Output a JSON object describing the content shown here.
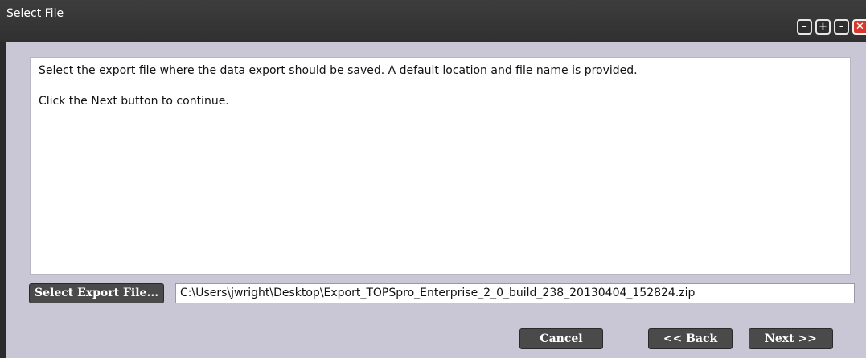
{
  "window": {
    "title": "Select File",
    "controls": {
      "minimize": "–",
      "restore": "+",
      "shrink": "-",
      "close": "✕"
    }
  },
  "message": {
    "line1": "Select the export file where the data export should be saved. A default location and file name is provided.",
    "line2": "Click the Next button to continue."
  },
  "file": {
    "button_label": "Select Export File...",
    "path": "C:\\Users\\jwright\\Desktop\\Export_TOPSpro_Enterprise_2_0_build_238_20130404_152824.zip"
  },
  "nav": {
    "cancel": "Cancel",
    "back": "<< Back",
    "next": "Next >>"
  },
  "colors": {
    "titlebar": "#333333",
    "body": "#c9c6d5",
    "button": "#4a4a4a",
    "close": "#d8382c"
  }
}
